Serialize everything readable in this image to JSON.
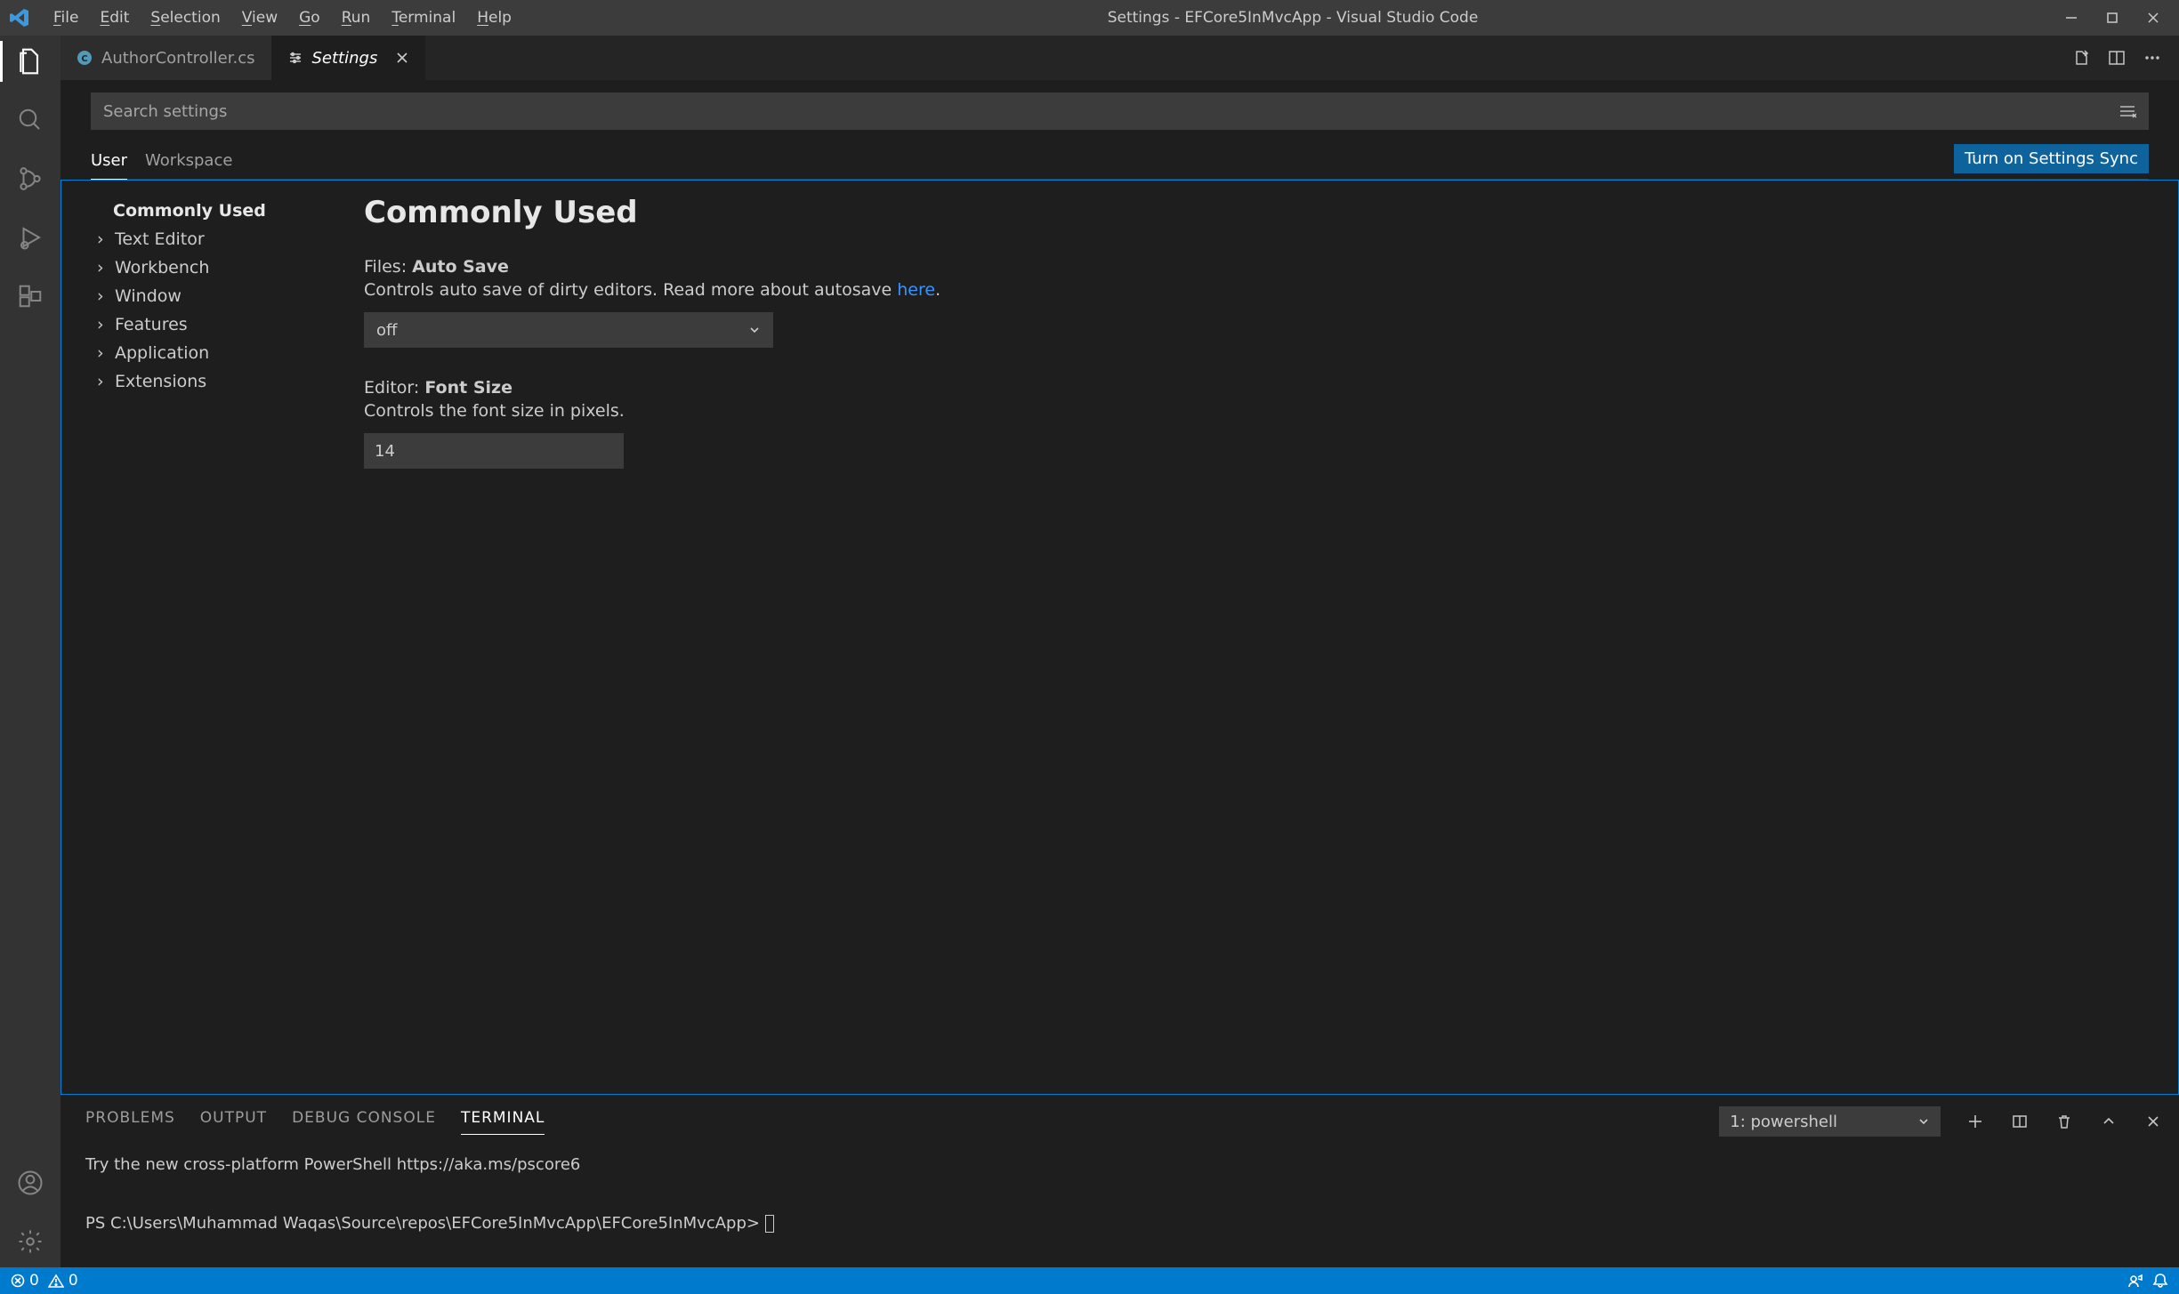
{
  "title": "Settings - EFCore5InMvcApp - Visual Studio Code",
  "menus": {
    "file": "File",
    "edit": "Edit",
    "selection": "Selection",
    "view": "View",
    "go": "Go",
    "run": "Run",
    "terminal": "Terminal",
    "help": "Help"
  },
  "tabs": {
    "t0": {
      "label": "AuthorController.cs"
    },
    "t1": {
      "label": "Settings"
    }
  },
  "search": {
    "placeholder": "Search settings"
  },
  "scope": {
    "user": "User",
    "workspace": "Workspace",
    "sync": "Turn on Settings Sync"
  },
  "tree": {
    "commonly": "Commonly Used",
    "i0": "Text Editor",
    "i1": "Workbench",
    "i2": "Window",
    "i3": "Features",
    "i4": "Application",
    "i5": "Extensions"
  },
  "list": {
    "heading": "Commonly Used",
    "autosave": {
      "prefix": "Files: ",
      "suffix": "Auto Save",
      "desc_a": "Controls auto save of dirty editors. Read more about autosave ",
      "desc_link": "here",
      "desc_b": ".",
      "value": "off"
    },
    "fontsize": {
      "prefix": "Editor: ",
      "suffix": "Font Size",
      "desc": "Controls the font size in pixels.",
      "value": "14"
    }
  },
  "panel": {
    "tabs": {
      "problems": "PROBLEMS",
      "output": "OUTPUT",
      "debug": "DEBUG CONSOLE",
      "terminal": "TERMINAL"
    },
    "select": "1: powershell",
    "line1": "Try the new cross-platform PowerShell https://aka.ms/pscore6",
    "line2": "PS C:\\Users\\Muhammad Waqas\\Source\\repos\\EFCore5InMvcApp\\EFCore5InMvcApp> "
  },
  "status": {
    "errors": "0",
    "warnings": "0"
  }
}
